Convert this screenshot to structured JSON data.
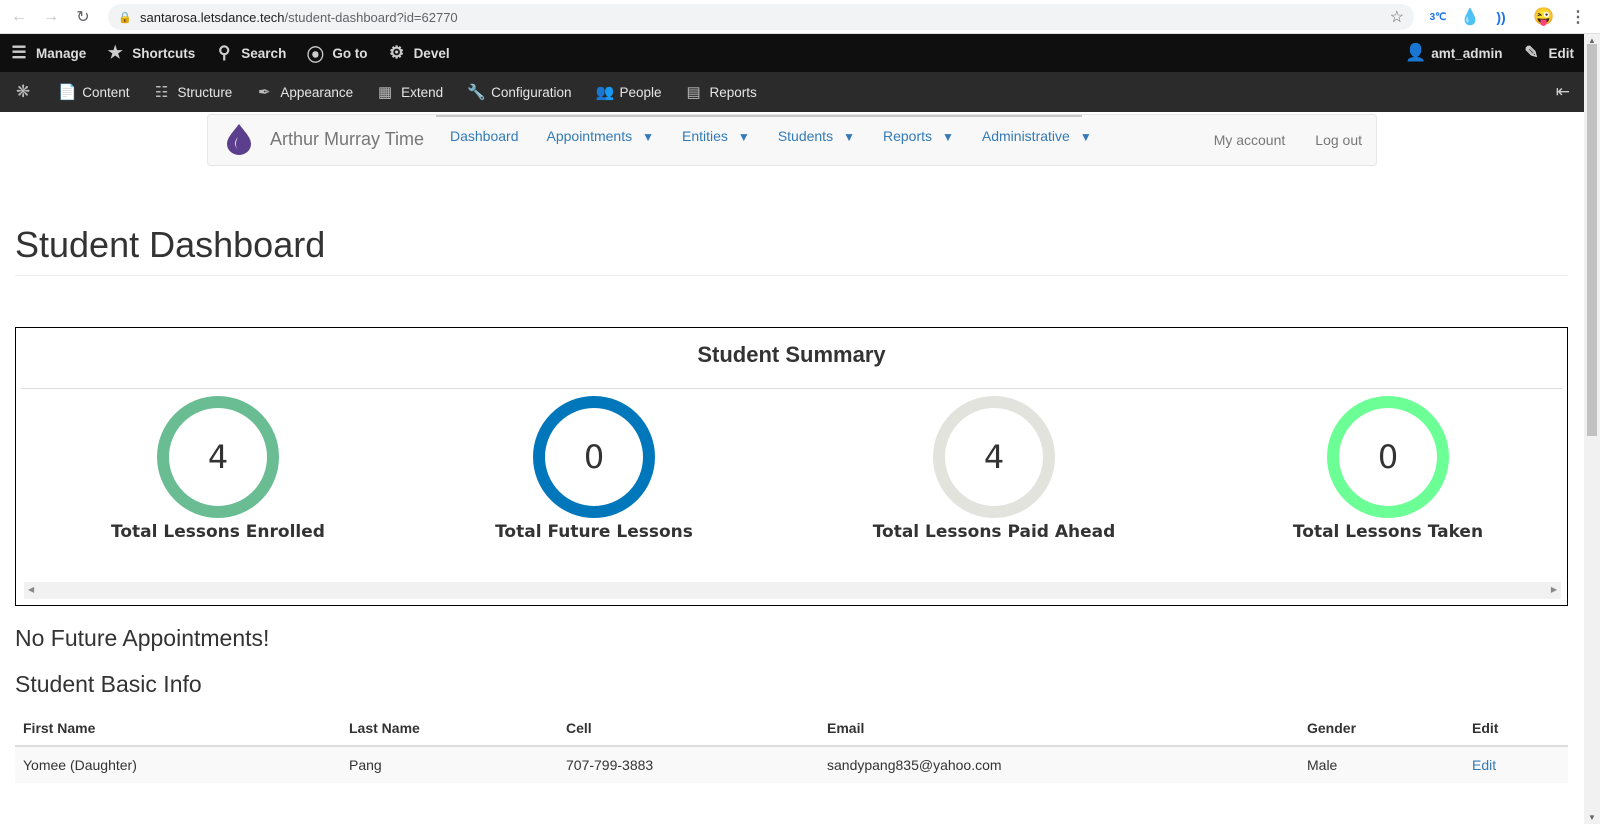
{
  "browser": {
    "url_host": "santarosa.letsdance.tech",
    "url_path": "/student-dashboard?id=62770",
    "ext_badge": "3℃"
  },
  "toolbar": {
    "items": [
      {
        "label": "Manage",
        "icon": "hamburger-icon"
      },
      {
        "label": "Shortcuts",
        "icon": "star-icon"
      },
      {
        "label": "Search",
        "icon": "search-icon"
      },
      {
        "label": "Go to",
        "icon": "goto-icon"
      },
      {
        "label": "Devel",
        "icon": "gear-icon"
      }
    ],
    "user": "amt_admin",
    "edit": "Edit"
  },
  "tray": {
    "items": [
      "Content",
      "Structure",
      "Appearance",
      "Extend",
      "Configuration",
      "People",
      "Reports"
    ]
  },
  "sitenav": {
    "brand": "Arthur Murray Time",
    "menu": [
      "Dashboard",
      "Appointments",
      "Entities",
      "Students",
      "Reports",
      "Administrative"
    ],
    "my_account": "My account",
    "log_out": "Log out"
  },
  "page": {
    "title": "Student Dashboard"
  },
  "summary": {
    "title": "Student Summary",
    "stats": [
      {
        "value": "4",
        "label": "Total Lessons Enrolled",
        "color": "#6abd93"
      },
      {
        "value": "0",
        "label": "Total Future Lessons",
        "color": "#0077bb"
      },
      {
        "value": "4",
        "label": "Total Lessons Paid Ahead",
        "color": "#e3e3de"
      },
      {
        "value": "0",
        "label": "Total Lessons Taken",
        "color": "#6bff95"
      }
    ]
  },
  "no_appointments": "No Future Appointments!",
  "basic_info": {
    "heading": "Student Basic Info",
    "columns": [
      "First Name",
      "Last Name",
      "Cell",
      "Email",
      "Gender",
      "Edit"
    ],
    "row": {
      "first_name": "Yomee (Daughter)",
      "last_name": "Pang",
      "cell": "707-799-3883",
      "email": "sandypang835@yahoo.com",
      "gender": "Male",
      "edit": "Edit"
    }
  }
}
